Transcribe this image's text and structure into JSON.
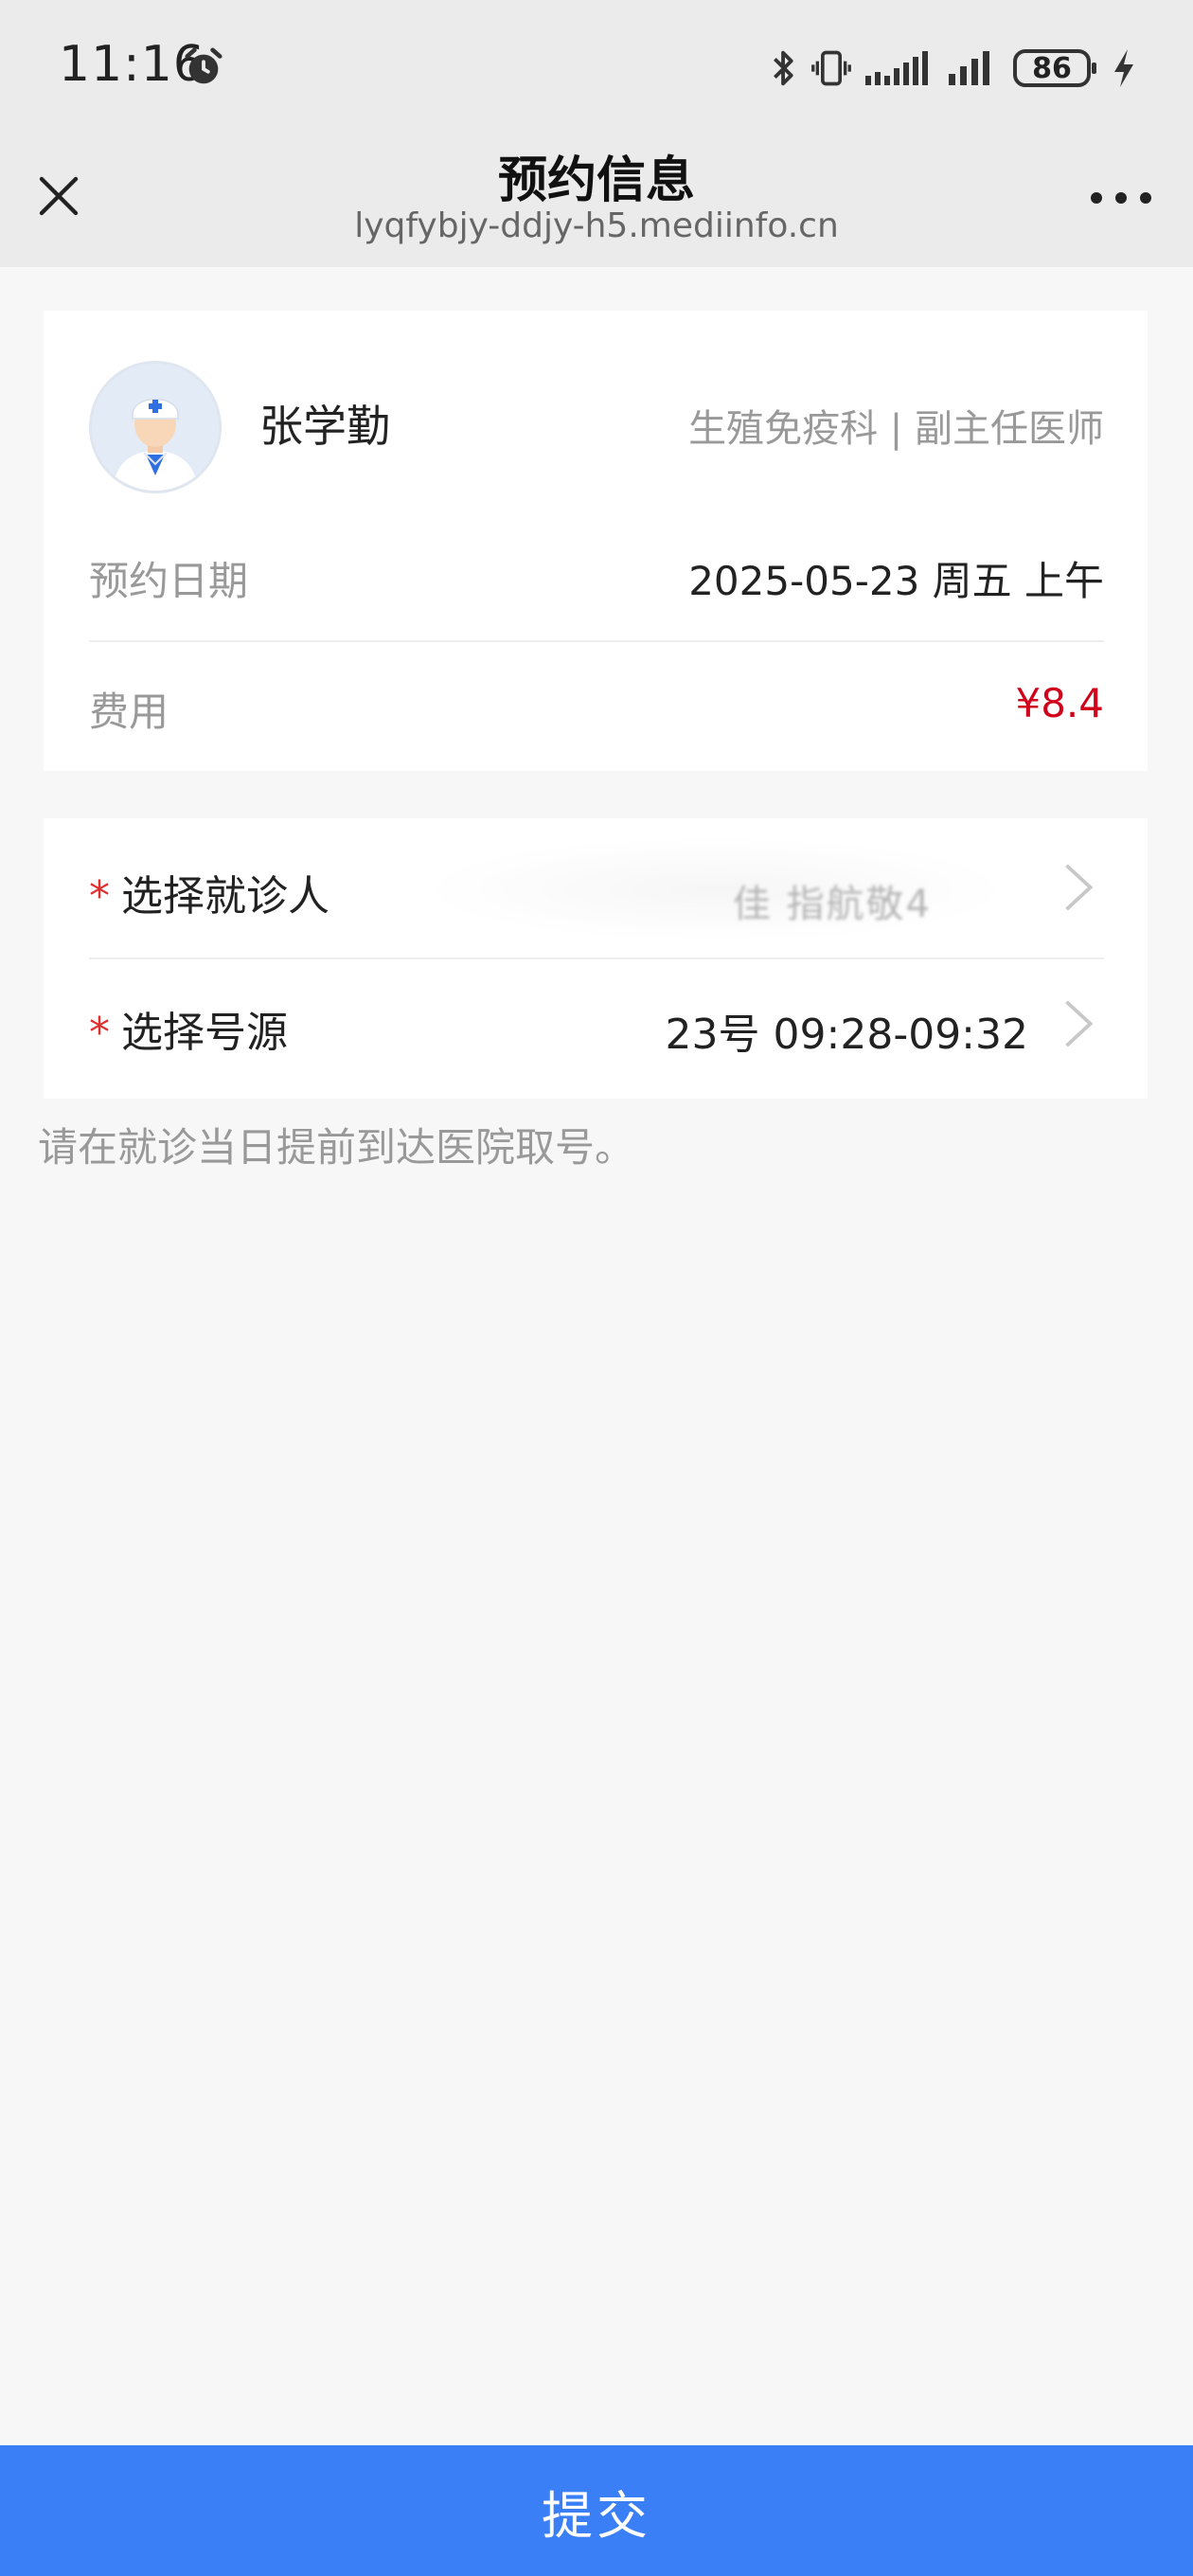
{
  "status_bar": {
    "time": "11:16",
    "battery": "86",
    "icons": [
      "alarm-icon",
      "bluetooth-icon",
      "vibrate-icon",
      "signal-icon",
      "signal-icon",
      "battery-icon",
      "charging-icon"
    ]
  },
  "header": {
    "title": "预约信息",
    "url": "lyqfybjy-ddjy-h5.mediinfo.cn",
    "close_icon": "close-icon",
    "more_icon": "more-icon"
  },
  "doctor": {
    "name": "张学勤",
    "dept_title": "生殖免疫科 | 副主任医师",
    "avatar_icon": "doctor-avatar"
  },
  "appointment": {
    "date_label": "预约日期",
    "date_value": "2025-05-23 周五 上午",
    "fee_label": "费用",
    "fee_value": "¥8.4"
  },
  "selection": {
    "required_mark": "*",
    "patient_label": "选择就诊人",
    "patient_value": "佳 指航敬4",
    "source_label": "选择号源",
    "source_value": "23号 09:28-09:32"
  },
  "notice": "请在就诊当日提前到达医院取号。",
  "submit_label": "提交",
  "colors": {
    "accent": "#3a7ff5",
    "price": "#d0021b",
    "required": "#e0302d"
  }
}
